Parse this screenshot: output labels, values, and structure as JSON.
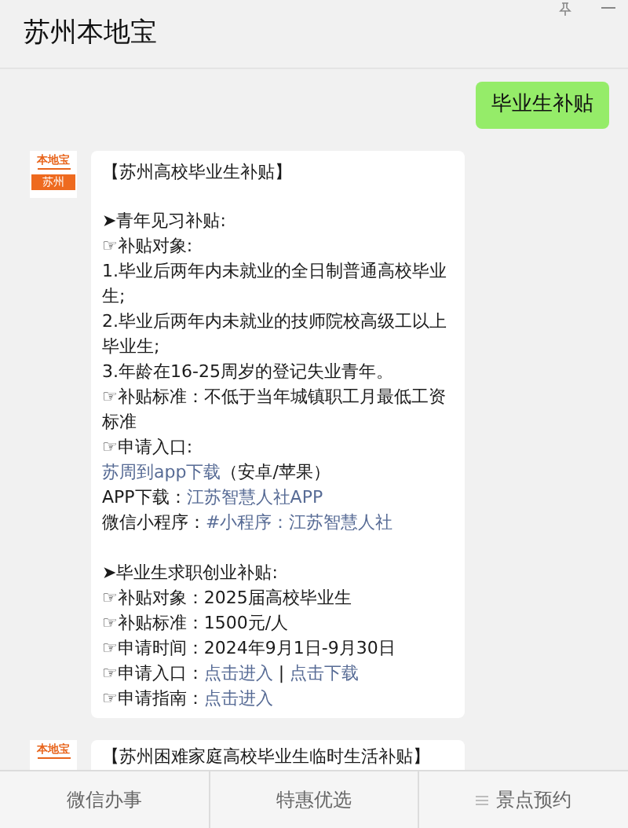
{
  "window": {
    "title": "苏州本地宝"
  },
  "messages": [
    {
      "kind": "outgoing",
      "text": "毕业生补贴"
    },
    {
      "kind": "incoming",
      "avatar": {
        "brand": "本地宝",
        "city": "苏州"
      },
      "title": "【苏州高校毕业生补贴】",
      "blocks": [
        [
          [
            {
              "text": "➤青年见习补贴:"
            }
          ],
          [
            {
              "text": "☞补贴对象:"
            }
          ],
          [
            {
              "text": "1.毕业后两年内未就业的全日制普通高校毕业生;"
            }
          ],
          [
            {
              "text": "2.毕业后两年内未就业的技师院校高级工以上毕业生;"
            }
          ],
          [
            {
              "text": "3.年龄在16-25周岁的登记失业青年。"
            }
          ],
          [
            {
              "text": "☞补贴标准：不低于当年城镇职工月最低工资标准"
            }
          ],
          [
            {
              "text": "☞申请入口:"
            }
          ],
          [
            {
              "text": "苏周到app下载",
              "link": true
            },
            {
              "text": "（安卓/苹果）"
            }
          ],
          [
            {
              "text": "APP下载："
            },
            {
              "text": "江苏智慧人社APP",
              "link": true
            }
          ],
          [
            {
              "text": "微信小程序："
            },
            {
              "text": "#小程序：江苏智慧人社",
              "link": true
            }
          ]
        ],
        [
          [
            {
              "text": "➤毕业生求职创业补贴:"
            }
          ],
          [
            {
              "text": "☞补贴对象：2025届高校毕业生"
            }
          ],
          [
            {
              "text": "☞补贴标准：1500元/人"
            }
          ],
          [
            {
              "text": "☞申请时间：2024年9月1日-9月30日"
            }
          ],
          [
            {
              "text": "☞申请入口："
            },
            {
              "text": "点击进入",
              "link": true
            },
            {
              "text": " | "
            },
            {
              "text": "点击下载",
              "link": true
            }
          ],
          [
            {
              "text": "☞申请指南："
            },
            {
              "text": "点击进入",
              "link": true
            }
          ]
        ]
      ]
    },
    {
      "kind": "incoming",
      "avatar": {
        "brand": "本地宝"
      },
      "title": "【苏州困难家庭高校毕业生临时生活补贴】"
    }
  ],
  "bottom_menu": [
    {
      "label": "微信办事",
      "has_menu_icon": false
    },
    {
      "label": "特惠优选",
      "has_menu_icon": false
    },
    {
      "label": "景点预约",
      "has_menu_icon": true
    }
  ]
}
